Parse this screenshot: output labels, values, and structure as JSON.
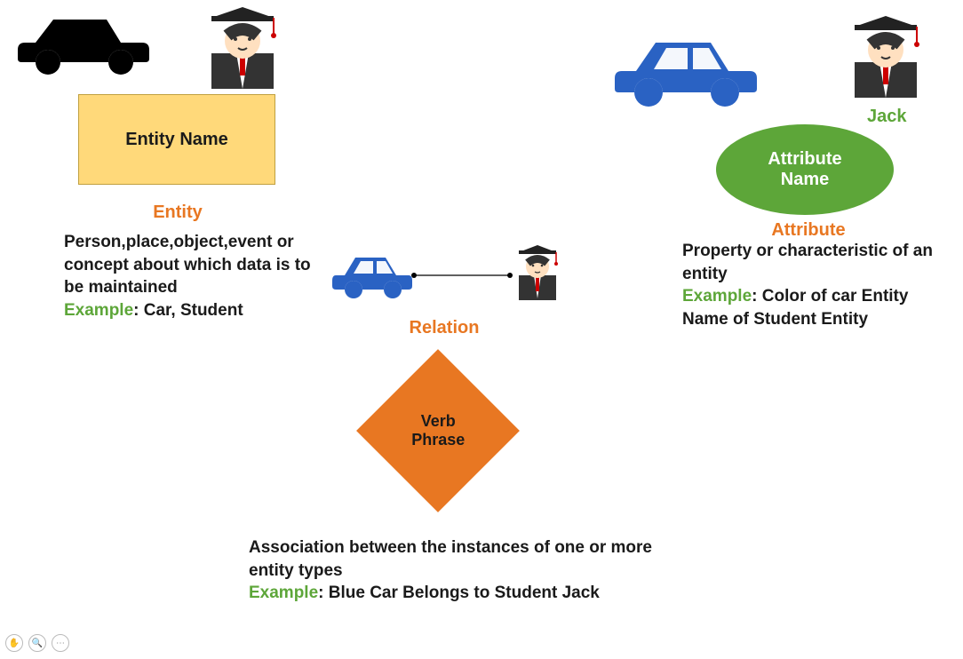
{
  "entity": {
    "box_label": "Entity Name",
    "title": "Entity",
    "desc": "Person,place,object,event or concept about which data is to be maintained",
    "example_label": "Example",
    "example_text": ": Car, Student"
  },
  "attribute": {
    "ellipse_label": "Attribute Name",
    "title": "Attribute",
    "jack_label": "Jack",
    "desc": "Property or characteristic of an entity",
    "example_label": "Example",
    "example_text": ": Color of car Entity Name of Student Entity"
  },
  "relation": {
    "diamond_label": "Verb Phrase",
    "title": "Relation",
    "desc": "Association between the instances of one or more entity types",
    "example_label": "Example",
    "example_text": ": Blue Car Belongs to Student Jack"
  }
}
